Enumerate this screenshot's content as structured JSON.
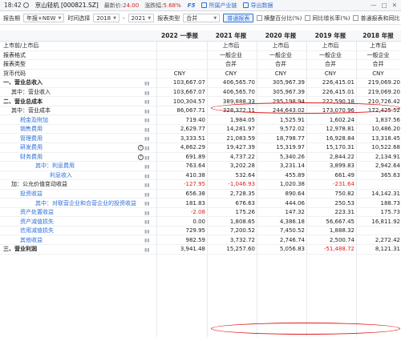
{
  "titlebar": {
    "time": "18:42",
    "stock": "京山轻机 [000821.SZ]",
    "price_label": "最新价:",
    "price": "24.00",
    "change_label": "涨跌幅:",
    "change": "5.68%",
    "f5": "F5",
    "link1": "所属产业链",
    "link2": "导出数据",
    "win_min": "—",
    "win_max": "□",
    "win_close": "✕"
  },
  "toolbar": {
    "period_label": "报告期",
    "period_value": "年报+NEW",
    "range_label": "时间选择",
    "year_from": "2018",
    "dash": "-",
    "year_to": "2021",
    "type_label": "报表类型",
    "type_value": "合并",
    "btn_normal": "普通报表",
    "chk1": "横整百分比(%)",
    "chk2": "同比增长率(%)",
    "chk3": "普通报表和同比"
  },
  "header": [
    "2022 一季报",
    "2021 年报",
    "2020 年报",
    "2019 年报",
    "2018 年报"
  ],
  "rows": [
    {
      "label": "上市前/上市后",
      "indent": 0,
      "vals": [
        "",
        "上市后",
        "上市后",
        "上市后",
        "上市后"
      ],
      "center": true
    },
    {
      "label": "报表格式",
      "indent": 0,
      "vals": [
        "",
        "一般企业",
        "一般企业",
        "一般企业",
        "一般企业"
      ],
      "center": true
    },
    {
      "label": "报表类型",
      "indent": 0,
      "vals": [
        "",
        "合并",
        "合并",
        "合并",
        "合并"
      ],
      "center": true
    },
    {
      "label": "货币代码",
      "indent": 0,
      "vals": [
        "CNY",
        "CNY",
        "CNY",
        "CNY",
        "CNY"
      ],
      "center": true
    },
    {
      "label": "一、营业总收入",
      "indent": 0,
      "bold": true,
      "vals": [
        "103,667.07",
        "406,565.70",
        "305,967.39",
        "226,415.01",
        "219,069.20"
      ],
      "bar": true
    },
    {
      "label": "其中：营业收入",
      "indent": 1,
      "vals": [
        "103,667.07",
        "406,565.70",
        "305,967.39",
        "226,415.01",
        "219,069.20"
      ],
      "bar": true
    },
    {
      "label": "二、营业总成本",
      "indent": 0,
      "bold": true,
      "vals": [
        "100,304.57",
        "389,888.33",
        "295,198.94",
        "222,590.18",
        "210,726.42"
      ],
      "bar": true
    },
    {
      "label": "其中：营业成本",
      "indent": 1,
      "vals": [
        "86,067.71",
        "328,372.11",
        "244,643.02",
        "173,070.96",
        "172,425.52"
      ],
      "bar": true
    },
    {
      "label": "税金及附加",
      "indent": 2,
      "vals": [
        "719.40",
        "1,984.05",
        "1,525.91",
        "1,602.24",
        "1,837.56"
      ],
      "bar": true
    },
    {
      "label": "销售费用",
      "indent": 2,
      "vals": [
        "2,629.77",
        "14,281.97",
        "9,572.02",
        "12,978.81",
        "10,486.20"
      ],
      "bar": true
    },
    {
      "label": "管理费用",
      "indent": 2,
      "vals": [
        "3,333.51",
        "21,083.59",
        "18,798.77",
        "16,928.84",
        "13,318.45"
      ],
      "bar": true
    },
    {
      "label": "研发费用",
      "indent": 2,
      "vals": [
        "4,862.29",
        "19,427.39",
        "15,319.97",
        "15,170.31",
        "10,522.68"
      ],
      "bar": true,
      "info": true
    },
    {
      "label": "财务费用",
      "indent": 2,
      "vals": [
        "691.89",
        "4,737.22",
        "5,340.26",
        "2,844.22",
        "2,134.91"
      ],
      "bar": true,
      "info": true
    },
    {
      "label": "其中：利息费用",
      "indent": 3,
      "vals": [
        "763.64",
        "3,202.28",
        "3,231.14",
        "3,899.83",
        "2,942.64"
      ],
      "bar": true
    },
    {
      "label": "利息收入",
      "indent": 4,
      "vals": [
        "410.38",
        "532.64",
        "455.89",
        "661.49",
        "365.63"
      ],
      "bar": true
    },
    {
      "label": "加：公允价值变动收益",
      "indent": 1,
      "vals": [
        "-127.95",
        "-1,046.93",
        "1,020.38",
        "-231.64",
        ""
      ],
      "neg": [
        0,
        1,
        3
      ],
      "bar": true
    },
    {
      "label": "投资收益",
      "indent": 2,
      "vals": [
        "656.38",
        "2,728.35",
        "890.64",
        "750.82",
        "14,142.31"
      ],
      "bar": true
    },
    {
      "label": "其中：对联营企业和合营企业的投资收益",
      "indent": 3,
      "vals": [
        "181.83",
        "676.63",
        "444.06",
        "250.53",
        "188.73"
      ],
      "bar": true
    },
    {
      "label": "资产处置收益",
      "indent": 2,
      "vals": [
        "-2.08",
        "175.26",
        "147.32",
        "223.31",
        "175.73"
      ],
      "neg": [
        0
      ],
      "bar": true
    },
    {
      "label": "资产减值损失",
      "indent": 2,
      "vals": [
        "0.00",
        "1,808.65",
        "4,386.18",
        "56,667.45",
        "16,811.92"
      ],
      "bar": true
    },
    {
      "label": "信用减值损失",
      "indent": 2,
      "vals": [
        "729.95",
        "7,200.52",
        "7,450.52",
        "1,888.32",
        ""
      ],
      "bar": true
    },
    {
      "label": "其他收益",
      "indent": 2,
      "vals": [
        "982.59",
        "3,732.72",
        "2,746.74",
        "2,500.74",
        "2,272.42"
      ],
      "bar": true
    },
    {
      "label": "三、营业利润",
      "indent": 0,
      "bold": true,
      "vals": [
        "3,941.48",
        "15,257.60",
        "5,056.83",
        "-51,488.72",
        "8,121.31"
      ],
      "neg": [
        3
      ],
      "bar": true
    }
  ]
}
